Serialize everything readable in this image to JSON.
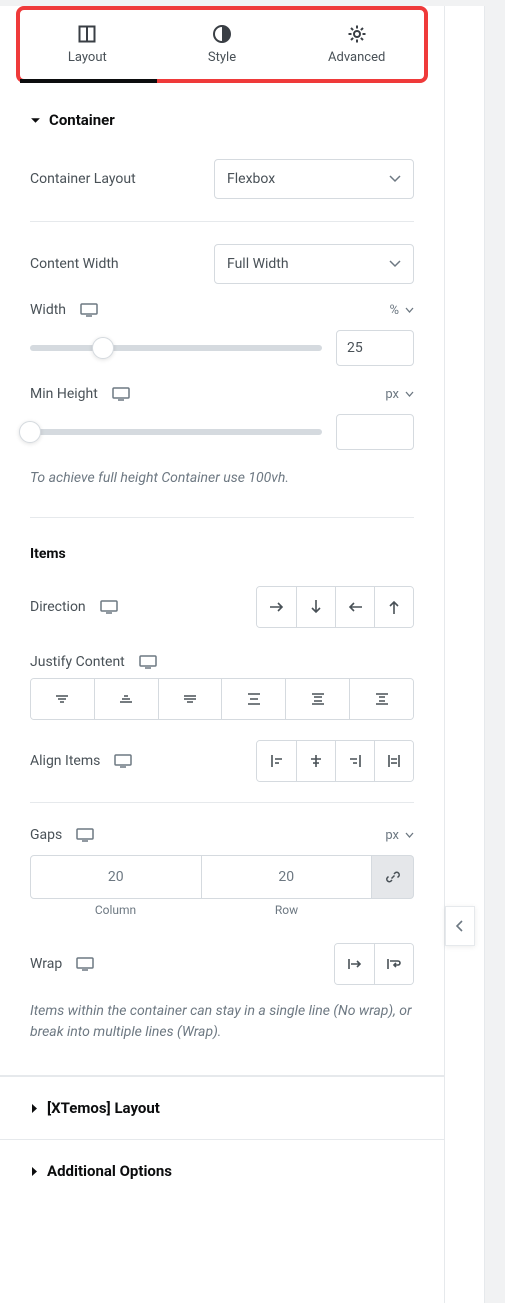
{
  "tabs": {
    "layout": "Layout",
    "style": "Style",
    "advanced": "Advanced"
  },
  "sections": {
    "container": "Container",
    "xtemos": "[XTemos] Layout",
    "additional": "Additional Options"
  },
  "fields": {
    "container_layout_label": "Container Layout",
    "container_layout_value": "Flexbox",
    "content_width_label": "Content Width",
    "content_width_value": "Full Width",
    "width_label": "Width",
    "width_unit": "%",
    "width_value": "25",
    "min_height_label": "Min Height",
    "min_height_unit": "px",
    "min_height_value": "",
    "full_height_hint": "To achieve full height Container use 100vh.",
    "items_title": "Items",
    "direction_label": "Direction",
    "justify_label": "Justify Content",
    "align_label": "Align Items",
    "gaps_label": "Gaps",
    "gaps_unit": "px",
    "gap_col_value": "20",
    "gap_row_value": "20",
    "gap_col_label": "Column",
    "gap_row_label": "Row",
    "wrap_label": "Wrap",
    "wrap_hint": "Items within the container can stay in a single line (No wrap), or break into multiple lines (Wrap)."
  }
}
